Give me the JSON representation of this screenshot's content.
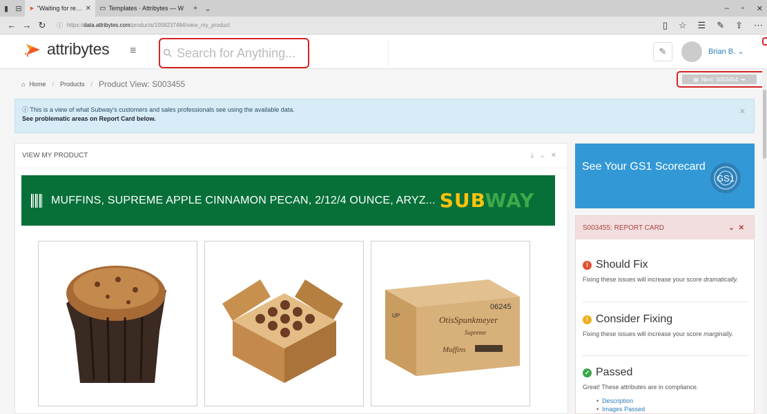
{
  "browser": {
    "tabs": [
      {
        "title": "\"Waiting for response fr",
        "active": true
      },
      {
        "title": "Templates · Attribytes — W",
        "active": false
      }
    ],
    "url_prefix": "https://",
    "url_domain": "data.attribytes.com",
    "url_path": "/products/1058237484/view_my_product"
  },
  "header": {
    "brand_name": "attribytes",
    "search_placeholder": "Search for Anything...",
    "user_name": "Brian B."
  },
  "breadcrumb": {
    "home": "Home",
    "products": "Products",
    "current": "Product View: S003455"
  },
  "next_button": {
    "label": "Next: S003454"
  },
  "info_banner": {
    "line1": "This is a view of what Subway's customers and sales professionals see using the available data.",
    "line2": "See problematic areas on Report Card below."
  },
  "main_panel": {
    "title": "VIEW MY PRODUCT",
    "product_title": "MUFFINS, SUPREME APPLE CINNAMON PECAN, 2/12/4 OUNCE, ARYZ...",
    "brand_part1": "SUB",
    "brand_part2": "WAY",
    "box_label_code": "06245",
    "box_label_up": "UP",
    "box_label_brand": "OtisSpunkmeyer",
    "box_label_sub": "Supreme",
    "box_label_product": "Muffins"
  },
  "gs1": {
    "label": "See Your GS1 Scorecard",
    "logo_text": "GS1"
  },
  "report_card": {
    "title": "S003455: REPORT CARD",
    "should_fix": {
      "title": "Should Fix",
      "desc": "Fixing these issues will increase your score",
      "emphasis": "dramatically."
    },
    "consider_fixing": {
      "title": "Consider Fixing",
      "desc": "Fixing these issues will increase your score",
      "emphasis": "marginally."
    },
    "passed": {
      "title": "Passed",
      "desc": "Great! These attributes are in compliance.",
      "items": [
        "Description",
        "Images Passed"
      ]
    }
  },
  "colors": {
    "green_banner": "#077038",
    "gs1_blue": "#3399d6",
    "report_head": "#f2dede",
    "link_blue": "#2e7cb8",
    "highlight_red": "#d42323"
  }
}
